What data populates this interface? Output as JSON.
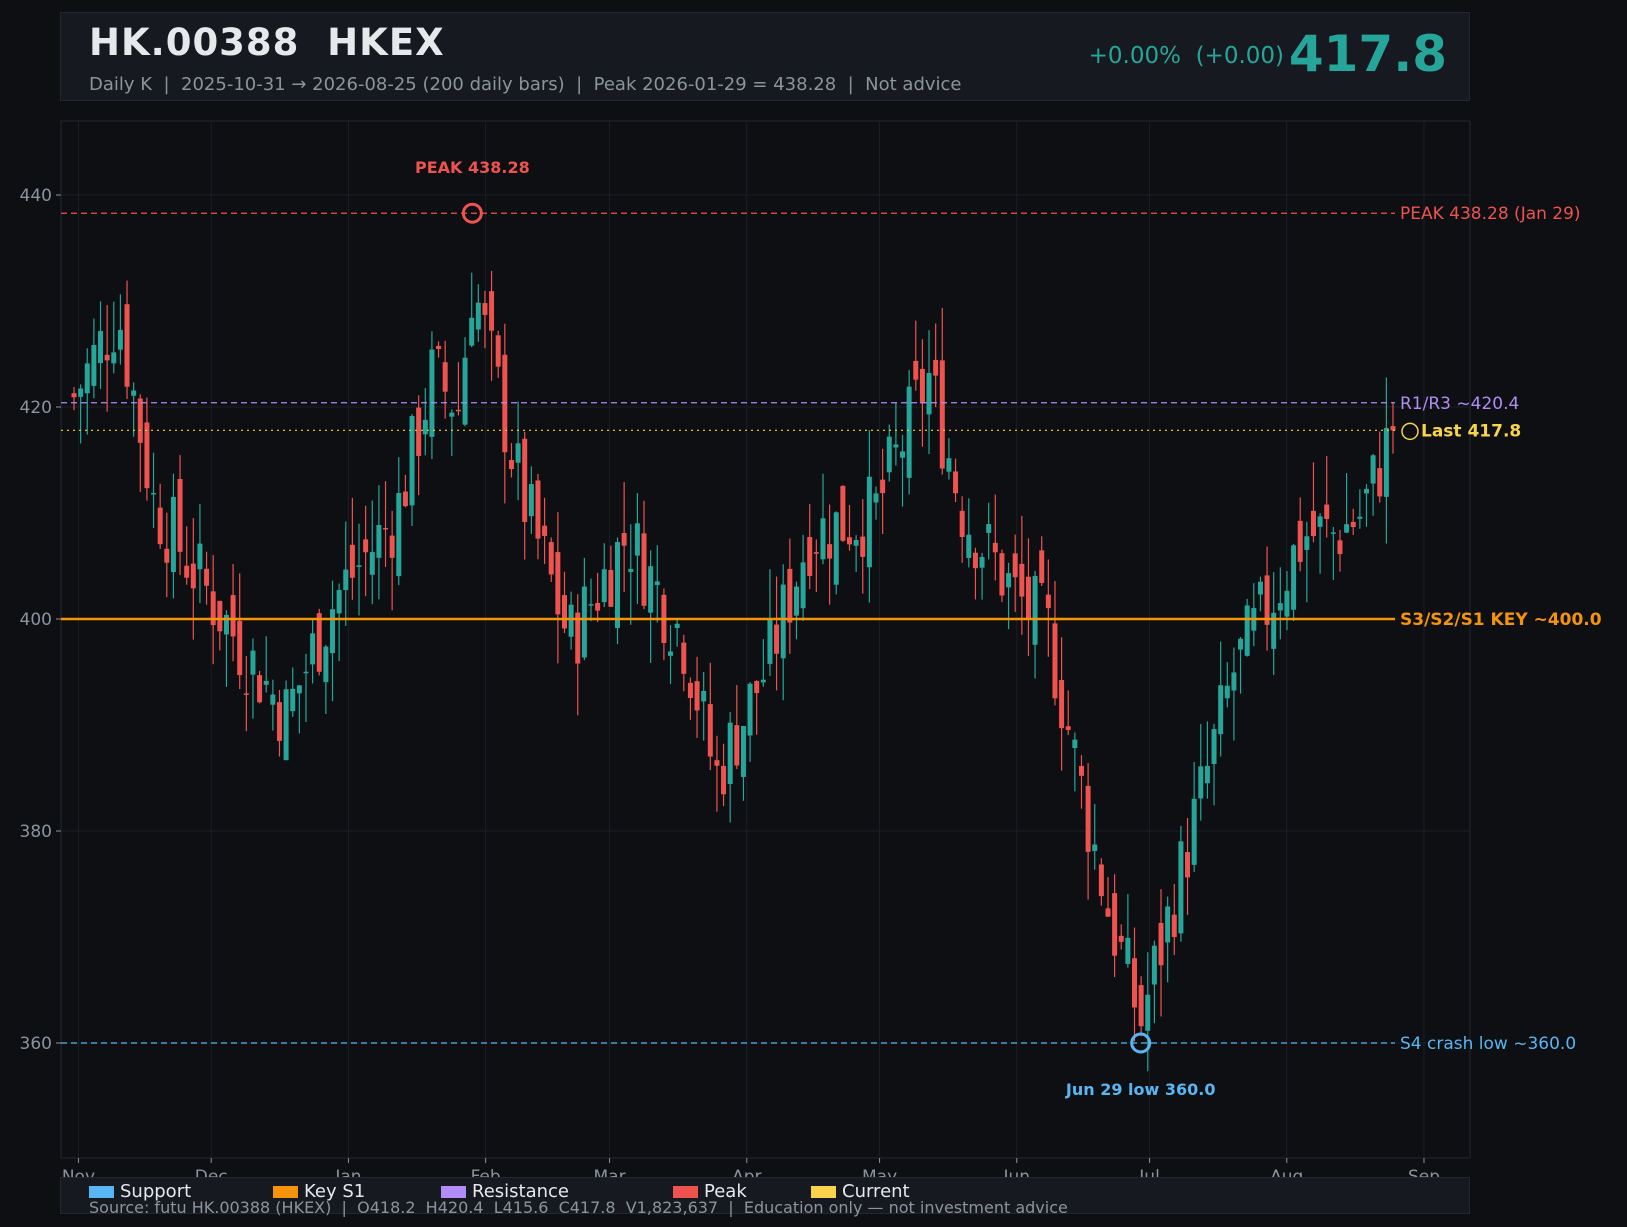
{
  "header": {
    "title": "HK.00388  HKEX",
    "subtitle": "Daily K  |  2025-10-31 → 2026-08-25 (200 daily bars)  |  Peak 2026-01-29 = 438.28  |  Not advice",
    "change": "+0.00%  (+0.00)",
    "price": "417.8"
  },
  "legend": {
    "items": [
      {
        "label": "Support",
        "color": "#58b6f2"
      },
      {
        "label": "Key S1",
        "color": "#f5940b"
      },
      {
        "label": "Resistance",
        "color": "#b18cf5"
      },
      {
        "label": "Peak",
        "color": "#ef5350"
      },
      {
        "label": "Current",
        "color": "#f9d34c"
      }
    ],
    "source": "Source: futu HK.00388 (HKEX)  |  O418.2  H420.4  L415.6  C417.8  V1,823,637  |  Education only — not investment advice"
  },
  "colors": {
    "up": "#26a69a",
    "down": "#ef5350",
    "grid": "#1b1f26",
    "axis": "#8b949e"
  },
  "chart_data": {
    "type": "candlestick",
    "ylim": [
      349,
      447
    ],
    "yticks": [
      360,
      380,
      400,
      420,
      440
    ],
    "xticks": [
      "Nov",
      "Dec",
      "Jan",
      "Feb",
      "Mar",
      "Apr",
      "May",
      "Jun",
      "Jul",
      "Aug",
      "Sep"
    ],
    "x_start": "2025-10-31",
    "x_end": "2026-08-25",
    "bar_count": 200,
    "path_points": [
      {
        "date": "2025-10-31",
        "close": 421
      },
      {
        "date": "2025-11-10",
        "close": 429
      },
      {
        "date": "2025-11-18",
        "close": 411
      },
      {
        "date": "2025-11-28",
        "close": 404
      },
      {
        "date": "2025-12-10",
        "close": 396
      },
      {
        "date": "2025-12-18",
        "close": 391
      },
      {
        "date": "2025-12-29",
        "close": 402
      },
      {
        "date": "2026-01-12",
        "close": 410
      },
      {
        "date": "2026-01-20",
        "close": 423
      },
      {
        "date": "2026-01-26",
        "close": 420
      },
      {
        "date": "2026-01-29",
        "close": 432
      },
      {
        "date": "2026-02-09",
        "close": 412
      },
      {
        "date": "2026-02-20",
        "close": 398
      },
      {
        "date": "2026-03-05",
        "close": 408
      },
      {
        "date": "2026-03-18",
        "close": 398
      },
      {
        "date": "2026-03-25",
        "close": 385
      },
      {
        "date": "2026-04-06",
        "close": 396
      },
      {
        "date": "2026-04-15",
        "close": 408
      },
      {
        "date": "2026-04-30",
        "close": 410
      },
      {
        "date": "2026-05-12",
        "close": 423
      },
      {
        "date": "2026-05-20",
        "close": 410
      },
      {
        "date": "2026-06-01",
        "close": 402
      },
      {
        "date": "2026-06-08",
        "close": 399
      },
      {
        "date": "2026-06-15",
        "close": 385
      },
      {
        "date": "2026-06-22",
        "close": 372
      },
      {
        "date": "2026-06-29",
        "close": 362
      },
      {
        "date": "2026-07-08",
        "close": 376
      },
      {
        "date": "2026-07-20",
        "close": 395
      },
      {
        "date": "2026-08-05",
        "close": 408
      },
      {
        "date": "2026-08-12",
        "close": 408
      },
      {
        "date": "2026-08-18",
        "close": 410
      },
      {
        "date": "2026-08-25",
        "close": 417.8
      }
    ],
    "levels": [
      {
        "name": "peak",
        "value": 438.28,
        "label": "PEAK 438.28 (Jan 29)",
        "color": "#ef5350",
        "style": "dashed"
      },
      {
        "name": "resistance",
        "value": 420.4,
        "label": "R1/R3 ~420.4",
        "color": "#b18cf5",
        "style": "dashed"
      },
      {
        "name": "current",
        "value": 417.8,
        "label": "Last 417.8",
        "color": "#f9d34c",
        "style": "dotted"
      },
      {
        "name": "key-support",
        "value": 400.0,
        "label": "S3/S2/S1 KEY ~400.0",
        "color": "#f5940b",
        "style": "solid"
      },
      {
        "name": "support",
        "value": 360.0,
        "label": "S4 crash low ~360.0",
        "color": "#58b6f2",
        "style": "dashed"
      }
    ],
    "annotations": [
      {
        "name": "peak",
        "text": "PEAK 438.28",
        "date": "2026-01-29",
        "value": 438.28,
        "color": "#ef5350"
      },
      {
        "name": "low",
        "text": "Jun 29 low 360.0",
        "date": "2026-06-29",
        "value": 360.0,
        "color": "#58b6f2"
      }
    ],
    "last_bar": {
      "open": 418.2,
      "high": 420.4,
      "low": 415.6,
      "close": 417.8,
      "volume": "1,823,637"
    }
  }
}
